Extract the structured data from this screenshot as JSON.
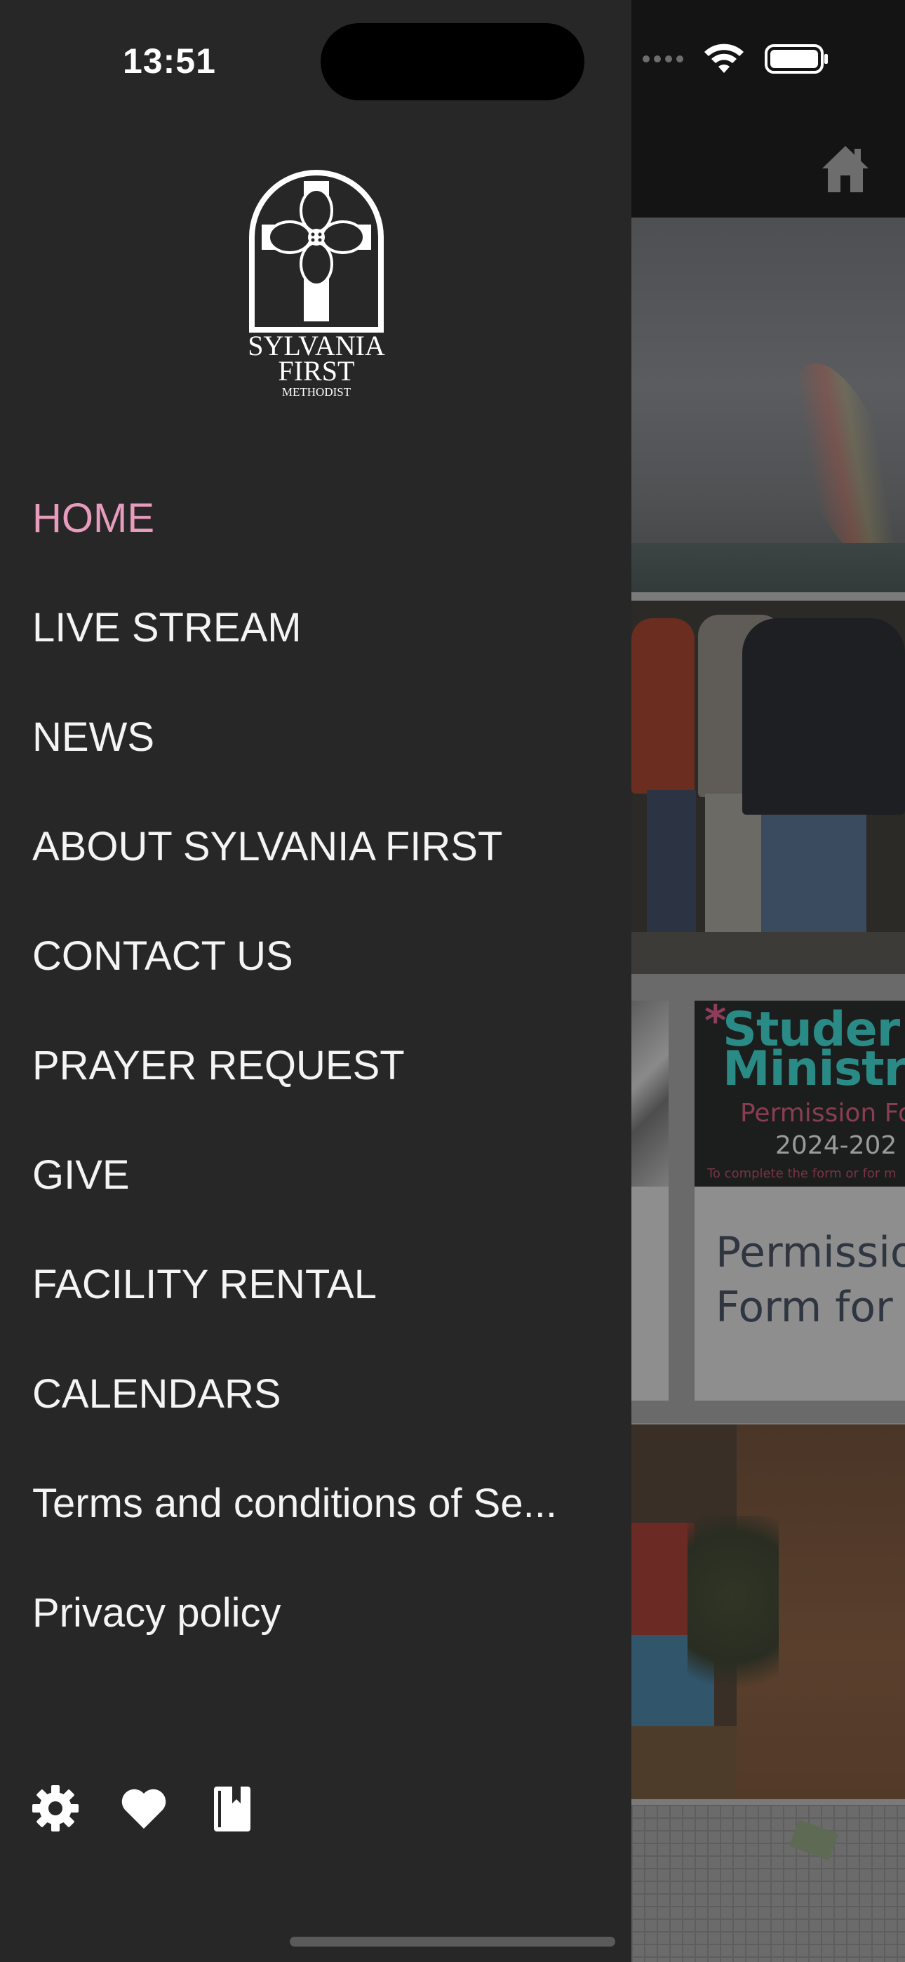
{
  "status_bar": {
    "time": "13:51"
  },
  "drawer": {
    "logo": {
      "line1": "SYLVANIA",
      "line2": "FIRST",
      "line3": "METHODIST"
    },
    "menu": [
      {
        "label": "HOME",
        "active": true
      },
      {
        "label": "LIVE STREAM",
        "active": false
      },
      {
        "label": "NEWS",
        "active": false
      },
      {
        "label": "ABOUT SYLVANIA FIRST",
        "active": false
      },
      {
        "label": "CONTACT US",
        "active": false
      },
      {
        "label": "PRAYER REQUEST",
        "active": false
      },
      {
        "label": "GIVE",
        "active": false
      },
      {
        "label": "FACILITY RENTAL",
        "active": false
      },
      {
        "label": "CALENDARS",
        "active": false
      },
      {
        "label": "Terms and conditions of Se...",
        "active": false
      },
      {
        "label": "Privacy policy",
        "active": false
      }
    ],
    "footer_icons": [
      "gear-icon",
      "heart-icon",
      "bookmark-book-icon"
    ]
  },
  "background": {
    "home_icon": "home-icon",
    "poster": {
      "line1": "Studer",
      "line2": "Ministr",
      "line3": "Permission Fo",
      "line4": "2024-202",
      "line5": "To complete the form or for m"
    },
    "card_title": "Permissio\nForm for"
  },
  "colors": {
    "drawer_bg": "#272727",
    "active_item": "#e89bbd",
    "text": "#f4f4f4"
  }
}
